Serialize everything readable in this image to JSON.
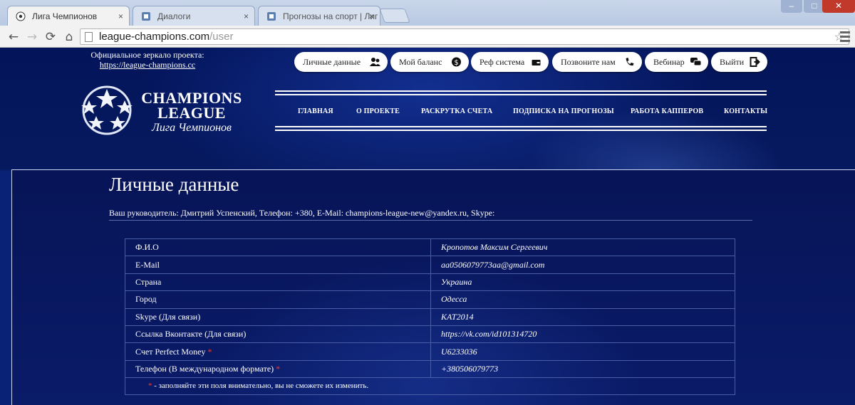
{
  "browser": {
    "tabs": [
      {
        "title": "Лига Чемпионов",
        "active": true
      },
      {
        "title": "Диалоги",
        "active": false
      },
      {
        "title": "Прогнозы на спорт | Лиг",
        "active": false
      }
    ],
    "url_domain": "league-champions.com",
    "url_path": "/user",
    "close_glyph": "×"
  },
  "header": {
    "mirror_text": "Официальное зеркало проекта:",
    "mirror_link": "https://league-champions.cc",
    "pills": [
      {
        "label": "Личные данные",
        "icon": "users-icon"
      },
      {
        "label": "Мой баланс",
        "icon": "dollar-icon"
      },
      {
        "label": "Реф система",
        "icon": "wallet-icon"
      },
      {
        "label": "Позвоните нам",
        "icon": "phone-icon"
      },
      {
        "label": "Вебинар",
        "icon": "chat-icon"
      },
      {
        "label": "Выйти",
        "icon": "logout-icon"
      }
    ],
    "logo_line1": "CHAMPIONS",
    "logo_line2": "LEAGUE",
    "logo_sub": "Лига Чемпионов",
    "nav": [
      "ГЛАВНАЯ",
      "О ПРОЕКТЕ",
      "РАСКРУТКА СЧЕТА",
      "ПОДПИСКА НА ПРОГНОЗЫ",
      "РАБОТА КАППЕРОВ",
      "КОНТАКТЫ"
    ]
  },
  "profile": {
    "title": "Личные данные",
    "manager": "Ваш руководитель: Дмитрий Успенский, Телефон: +380, E-Mail: champions-league-new@yandex.ru, Skype:",
    "rows": [
      {
        "label": "Ф.И.О",
        "value": "Кропотов Максим Сергеевич",
        "required": false
      },
      {
        "label": "E-Mail",
        "value": "aa0506079773aa@gmail.com",
        "required": false
      },
      {
        "label": "Страна",
        "value": "Украина",
        "required": false
      },
      {
        "label": "Город",
        "value": "Одесса",
        "required": false
      },
      {
        "label": "Skype (Для связи)",
        "value": "KAT2014",
        "required": false
      },
      {
        "label": "Ссылка Вконтакте (Для связи)",
        "value": "https://vk.com/id101314720",
        "required": false
      },
      {
        "label": "Счет Perfect Money",
        "value": "U6233036",
        "required": true
      },
      {
        "label": "Телефон (В международном формате)",
        "value": "+380506079773",
        "required": true
      }
    ],
    "required_mark": "*",
    "note": "- заполняйте эти поля внимательно, вы не сможете их изменить."
  },
  "colors": {
    "page_bg": "#0a1a5c",
    "required": "#e0403a"
  }
}
